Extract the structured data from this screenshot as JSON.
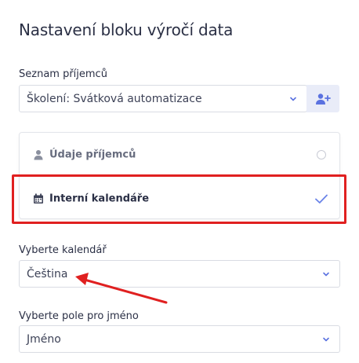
{
  "title": "Nastavení bloku výročí data",
  "recipients": {
    "label": "Seznam příjemců",
    "selected": "Školení: Svátková automatizace",
    "icon": "chevron-down-icon",
    "add_icon": "add-user-icon"
  },
  "source_options": [
    {
      "label": "Údaje příjemců",
      "icon": "person-icon",
      "selected": false
    },
    {
      "label": "Interní kalendáře",
      "icon": "calendar-icon",
      "selected": true
    }
  ],
  "calendar": {
    "label": "Vyberte kalendář",
    "selected": "Čeština"
  },
  "name_field": {
    "label": "Vyberte pole pro jméno",
    "selected": "Jméno"
  },
  "colors": {
    "accent": "#5b72e0",
    "annotation": "#e02020"
  }
}
